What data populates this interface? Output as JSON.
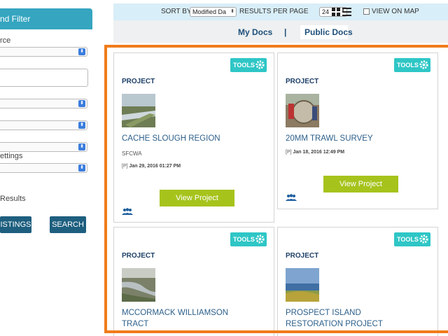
{
  "sidebar": {
    "header": "nd Filter",
    "label_source": "rce",
    "label_settings": "ettings",
    "label_results": "Results",
    "listings_button": "ISTINGS",
    "search_button": "SEARCH"
  },
  "toolbar": {
    "sort_by_label": "SORT BY",
    "sort_value": "Modified Da",
    "results_per_page_label": "RESULTS PER PAGE",
    "results_per_page_value": "24",
    "view_on_map_label": "VIEW ON MAP"
  },
  "doc_tabs": {
    "my_docs": "My Docs",
    "separator": "|",
    "public_docs": "Public Docs"
  },
  "cards": [
    {
      "tools_label": "TOOLS",
      "kind": "PROJECT",
      "title": "CACHE SLOUGH REGION",
      "org": "SFCWA",
      "date_prefix": "[P]",
      "date": "Jan 29, 2016 01:27 PM",
      "view_label": "View Project"
    },
    {
      "tools_label": "TOOLS",
      "kind": "PROJECT",
      "title": "20MM TRAWL SURVEY",
      "date_prefix": "[P]",
      "date": "Jan 18, 2016 12:49 PM",
      "view_label": "View Project"
    },
    {
      "tools_label": "TOOLS",
      "kind": "PROJECT",
      "title_line1": "MCCORMACK WILLIAMSON",
      "title_line2": "TRACT"
    },
    {
      "tools_label": "TOOLS",
      "kind": "PROJECT",
      "title_line1": "PROSPECT ISLAND",
      "title_line2": "RESTORATION PROJECT"
    }
  ],
  "colors": {
    "sidebar_header": "#35a5c0",
    "tools_button": "#2fc6c6",
    "view_button": "#a6c31c",
    "highlight_frame": "#f07b1a",
    "dark_button": "#1e5f7f"
  }
}
